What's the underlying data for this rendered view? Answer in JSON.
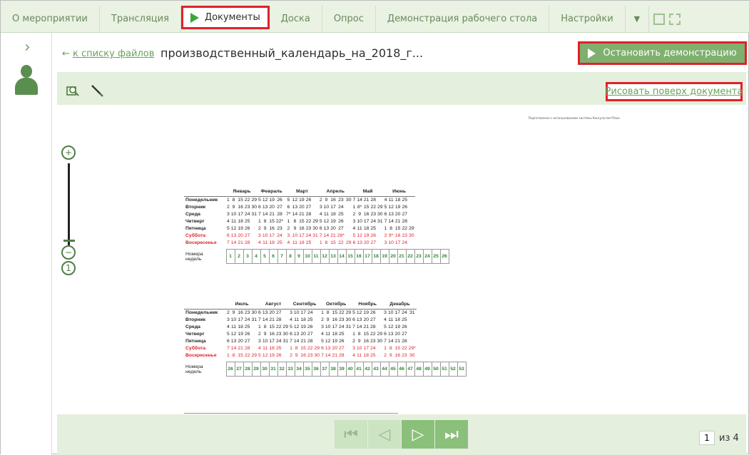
{
  "tabs": [
    {
      "label": "О мероприятии"
    },
    {
      "label": "Трансляция"
    },
    {
      "label": "Документы"
    },
    {
      "label": "Доска"
    },
    {
      "label": "Опрос"
    },
    {
      "label": "Демонстрация рабочего стола"
    },
    {
      "label": "Настройки"
    }
  ],
  "dropdown_glyph": "▼",
  "sidebar": {
    "chevron": "›"
  },
  "header": {
    "back_arrow": "←",
    "back_label": "к списку файлов",
    "file_name": "производственный_календарь_на_2018_г...",
    "stop_button": "Остановить демонстрацию"
  },
  "toolbar": {
    "draw_link": "Рисовать поверх документа"
  },
  "document": {
    "note": "Подготовлено с использованием системы КонсультантПлюс",
    "day_labels": [
      "Понедельник",
      "Вторник",
      "Среда",
      "Четверг",
      "Пятница",
      "Суббота",
      "Воскресенье"
    ],
    "weeks_label_1": "Номера",
    "weeks_label_2": "недель",
    "half1": {
      "months": [
        "Январь",
        "Февраль",
        "Март",
        "Апрель",
        "Май",
        "Июнь"
      ],
      "weeks": [
        "1",
        "2",
        "3",
        "4",
        "5",
        "6",
        "7",
        "8",
        "9",
        "10",
        "11",
        "12",
        "13",
        "14",
        "15",
        "16",
        "17",
        "18",
        "19",
        "20",
        "21",
        "22",
        "23",
        "24",
        "25",
        "26"
      ]
    },
    "half2": {
      "months": [
        "Июль",
        "Август",
        "Сентябрь",
        "Октябрь",
        "Ноябрь",
        "Декабрь"
      ],
      "weeks": [
        "26",
        "27",
        "28",
        "29",
        "30",
        "31",
        "32",
        "33",
        "34",
        "35",
        "36",
        "37",
        "38",
        "39",
        "40",
        "41",
        "42",
        "43",
        "44",
        "45",
        "46",
        "47",
        "48",
        "49",
        "50",
        "51",
        "52",
        "53"
      ]
    },
    "cal1": [
      [
        "1 8 15 22 29",
        "5 12 19 26",
        "5 12 19 26",
        "2 9 16 23 30",
        "7 14 21 28",
        "4 11 18 25"
      ],
      [
        "2 9 16 23 30",
        "6 13 20 27",
        "6 13 20 27",
        "3 10 17 24",
        "1 8* 15 22 29",
        "5 12 19 26"
      ],
      [
        "3 10 17 24 31",
        "7 14 21 28",
        "7* 14 21 28",
        "4 11 18 25",
        "2 9 16 23 30",
        "6 13 20 27"
      ],
      [
        "4 11 18 25",
        "1 8 15 22*",
        "1 8 15 22 29",
        "5 12 19 26",
        "3 10 17 24 31",
        "7 14 21 28"
      ],
      [
        "5 12 19 26",
        "2 9 16 23",
        "2 9 16 23 30",
        "6 13 20 27",
        "4 11 18 25",
        "1 8 15 22 29"
      ],
      [
        "6 13 20 27",
        "3 10 17 24",
        "3 10 17 24 31",
        "7 14 21 28*",
        "5 12 19 26",
        "2 9* 16 23 30"
      ],
      [
        "7 14 21 28",
        "4 11 18 25",
        "4 11 18 25",
        "1 8 15 22 29",
        "6 13 20 27",
        "3 10 17 24"
      ]
    ],
    "cal2": [
      [
        "2 9 16 23 30",
        "6 13 20 27",
        "3 10 17 24",
        "1 8 15 22 29",
        "5 12 19 26",
        "3 10 17 24 31"
      ],
      [
        "3 10 17 24 31",
        "7 14 21 28",
        "4 11 18 25",
        "2 9 16 23 30",
        "6 13 20 27",
        "4 11 18 25"
      ],
      [
        "4 11 18 25",
        "1 8 15 22 29",
        "5 12 19 26",
        "3 10 17 24 31",
        "7 14 21 28",
        "5 12 19 26"
      ],
      [
        "5 12 19 26",
        "2 9 16 23 30",
        "6 13 20 27",
        "4 11 18 25",
        "1 8 15 22 29",
        "6 13 20 27"
      ],
      [
        "6 13 20 27",
        "3 10 17 24 31",
        "7 14 21 28",
        "5 12 19 26",
        "2 9 16 23 30",
        "7 14 21 28"
      ],
      [
        "7 14 21 28",
        "4 11 18 25",
        "1 8 15 22 29",
        "6 13 20 27",
        "3 10 17 24",
        "1 8 15 22 29*"
      ],
      [
        "1 8 15 22 29",
        "5 12 19 26",
        "2 9 16 23 30",
        "7 14 21 28",
        "4 11 18 25",
        "2 9 16 23 30"
      ]
    ]
  },
  "pager": {
    "current": "1",
    "of_label": "из 4"
  },
  "colors": {
    "accent": "#7fb06d",
    "highlight": "#e0212b",
    "panel": "#e4efdd"
  }
}
